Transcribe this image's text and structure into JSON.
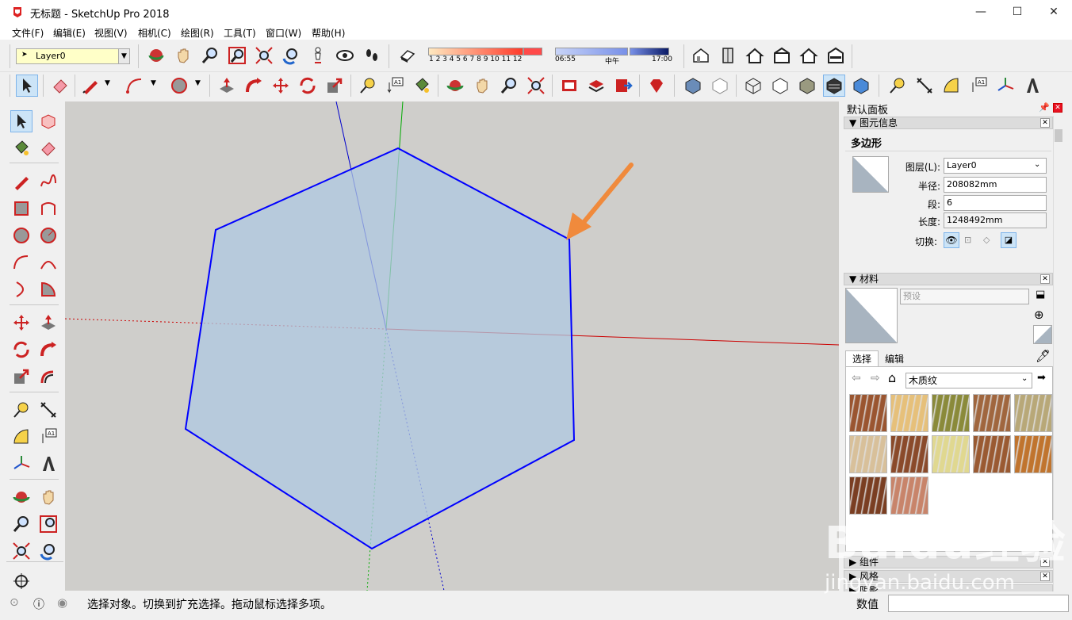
{
  "window": {
    "title": "无标题 - SketchUp Pro 2018",
    "minimize": "—",
    "maximize": "☐",
    "close": "✕"
  },
  "menu": [
    "文件(F)",
    "编辑(E)",
    "视图(V)",
    "相机(C)",
    "绘图(R)",
    "工具(T)",
    "窗口(W)",
    "帮助(H)"
  ],
  "layers_toolbar": {
    "current_layer": "Layer0"
  },
  "shadow_toolbar": {
    "months": "1 2 3 4 5 6 7 8 9 10 11 12",
    "time_start": "06:55",
    "time_mid": "中午",
    "time_end": "17:00"
  },
  "right_panel": {
    "tray_title": "默认面板",
    "entity_info": {
      "header": "图元信息",
      "entity_type": "多边形",
      "layer_label": "图层(L):",
      "layer_value": "Layer0",
      "radius_label": "半径:",
      "radius_value": "208082mm",
      "segments_label": "段:",
      "segments_value": "6",
      "length_label": "长度:",
      "length_value": "1248492mm",
      "toggle_label": "切换:"
    },
    "materials": {
      "header": "材料",
      "name_placeholder": "预设",
      "tab_select": "选择",
      "tab_edit": "编辑",
      "collection": "木质纹",
      "swatch_colors": [
        "#9a5530",
        "#e6c07a",
        "#8a8a3a",
        "#a0663e",
        "#b8a878",
        "#d8c09a",
        "#8a4a2a",
        "#e0d890",
        "#9a5a32",
        "#c0742e",
        "#7a3e22",
        "#c8846a"
      ]
    },
    "collapsed": [
      "组件",
      "风格",
      "阴影"
    ]
  },
  "status": {
    "message": "选择对象。切换到扩充选择。拖动鼠标选择多项。",
    "value_label": "数值"
  },
  "watermark": {
    "main": "Baidu经验",
    "sub": "jingyan.baidu.com"
  },
  "colors": {
    "viewport_bg": "#cfcecb",
    "polygon_fill": "#bccbd9",
    "polygon_edge": "#0000ff",
    "axis_red": "#cc0000",
    "axis_green": "#00aa00",
    "axis_blue": "#0000cc",
    "arrow": "#f08a3c"
  }
}
